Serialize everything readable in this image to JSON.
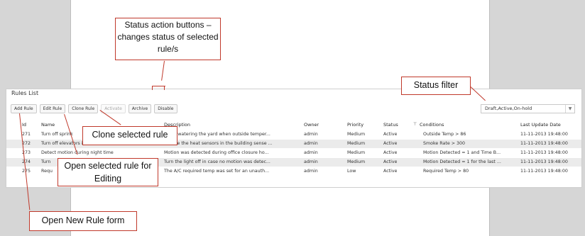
{
  "callouts": {
    "status_actions": "Status action buttons – changes status of selected rule/s",
    "status_filter": "Status filter",
    "clone": "Clone selected rule",
    "edit": "Open selected rule for Editing",
    "new_rule": "Open New Rule form"
  },
  "grid": {
    "title": "Rules List",
    "toolbar": {
      "add": "Add Rule",
      "edit": "Edit Rule",
      "clone": "Clone Rule",
      "activate": "Activate",
      "archive": "Archive",
      "disable": "Disable"
    },
    "status_filter_value": "Draft,Active,On-hold",
    "columns": {
      "id": "Id",
      "name": "Name",
      "description": "Description",
      "owner": "Owner",
      "priority": "Priority",
      "status": "Status",
      "conditions": "Conditions",
      "last_update": "Last Update Date"
    },
    "rows": [
      {
        "id": "271",
        "name": "Turn off sprink",
        "description": "Avoid watering the yard when outside temper...",
        "owner": "admin",
        "priority": "Medium",
        "status": "Active",
        "conditions": "Outside Temp > 86",
        "last_update": "11-11-2013 19:48:00"
      },
      {
        "id": "272",
        "name": "Turn off elevators in case of fire",
        "description": "In case the heat sensors in the building sense ...",
        "owner": "admin",
        "priority": "Medium",
        "status": "Active",
        "conditions": "Smoke Rate > 300",
        "last_update": "11-11-2013 19:48:00"
      },
      {
        "id": "273",
        "name": "Detect motion during night time",
        "description": "Motion was detected during office closure ho...",
        "owner": "admin",
        "priority": "Medium",
        "status": "Active",
        "conditions": "Motion Detected = 1 and Time B...",
        "last_update": "11-11-2013 19:48:00"
      },
      {
        "id": "274",
        "name": "Turn",
        "description": "Turn the light off in case no motion was detec...",
        "owner": "admin",
        "priority": "Medium",
        "status": "Active",
        "conditions": "Motion Detected = 1 for the last ...",
        "last_update": "11-11-2013 19:48:00"
      },
      {
        "id": "275",
        "name": "Requ",
        "description": "The A/C required temp was set for an unauth...",
        "owner": "admin",
        "priority": "Low",
        "status": "Active",
        "conditions": "Required Temp > 80",
        "last_update": "11-11-2013 19:48:00"
      }
    ]
  }
}
